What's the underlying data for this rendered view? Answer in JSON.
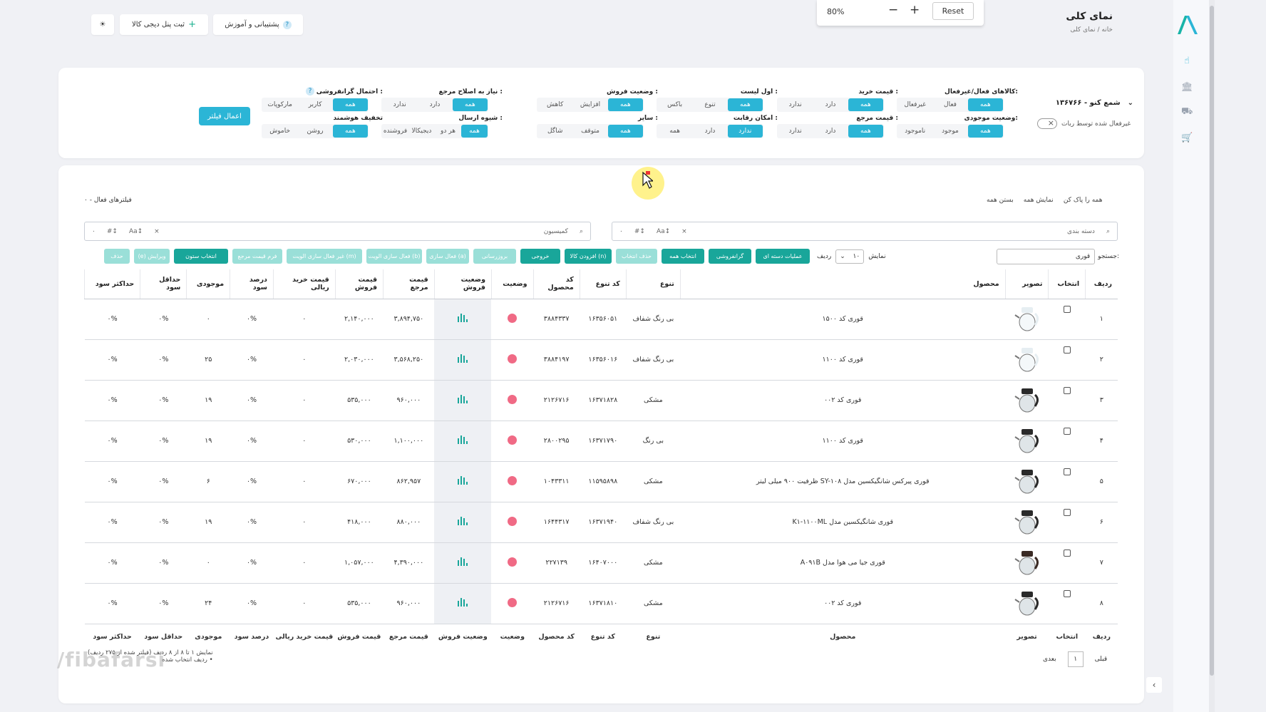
{
  "header": {
    "page_title": "نمای کلی",
    "breadcrumb_home": "خانه",
    "breadcrumb_sep": "/",
    "breadcrumb_current": "نمای کلی",
    "support_label": "پشتیبانی و آموزش",
    "register_panel_label": "ثبت پنل دیجی کالا"
  },
  "zoom": {
    "value": "80%",
    "reset_label": "Reset"
  },
  "filters": {
    "shop_name": "شمع کنو - ۱۳۶۷۶۶",
    "robot_toggle_label": "غیرفعال شده توسط ربات",
    "apply_label": "اعمال فیلتر",
    "groups": [
      {
        "label": "کالاهای فعال/غیرفعال:",
        "options": [
          "همه",
          "فعال",
          "غیرفعال"
        ],
        "active": 0
      },
      {
        "label": "وضعیت موجودی:",
        "options": [
          "همه",
          "موجود",
          "ناموجود"
        ],
        "active": 0
      },
      {
        "label": "قیمت خرید :",
        "options": [
          "همه",
          "دارد",
          "ندارد"
        ],
        "active": 0
      },
      {
        "label": "قیمت مرجع :",
        "options": [
          "همه",
          "دارد",
          "ندارد"
        ],
        "active": 0
      },
      {
        "label": "اول لیست :",
        "options": [
          "همه",
          "تنوع",
          "باکس"
        ],
        "active": 0
      },
      {
        "label": "امکان رقابت :",
        "options": [
          "ندارد",
          "دارد",
          "همه"
        ],
        "active": 0
      },
      {
        "label": "وضعیت فروش :",
        "options": [
          "همه",
          "افزایش",
          "کاهش"
        ],
        "active": 0
      },
      {
        "label": "سایر :",
        "options": [
          "همه",
          "متوقف",
          "شاگل"
        ],
        "active": 0
      },
      {
        "label": "نیاز به اصلاح مرجع :",
        "options": [
          "همه",
          "دارد",
          "ندارد"
        ],
        "active": 0
      },
      {
        "label": "شیوه ارسال :",
        "options": [
          "همه",
          "هر دو",
          "دیجیکالا",
          "فروشنده"
        ],
        "active": 0
      },
      {
        "label": "احتمال گرانفروشی :",
        "options": [
          "همه",
          "کاربر",
          "مارکوپات"
        ],
        "active": 0
      },
      {
        "label": "تخفیف هوشمند",
        "options": [
          "همه",
          "روشن",
          "خاموش"
        ],
        "active": 0
      }
    ]
  },
  "list": {
    "select_all_label": "همه را پاک کن",
    "show_all_label": "نمایش همه",
    "close_all_label": "بستن همه",
    "active_filters_label": "فیلترهای فعال - ۰",
    "category_search_placeholder": "دسته بندی",
    "commission_search_placeholder": "کمیسیون",
    "search_label": "جستجو:",
    "search_value": "قوری",
    "rows_label_show": "نمایش",
    "rows_label_rows": "ردیف",
    "rows_value": "۱۰",
    "toolbar": [
      {
        "label": "عملیات دسته ای",
        "style": "dark"
      },
      {
        "label": "گرانفروشی",
        "style": "dark"
      },
      {
        "label": "انتخاب همه",
        "style": "dark"
      },
      {
        "label": "حذف انتخاب",
        "style": "light"
      },
      {
        "label": "افزودن کالا (n)",
        "style": "dark"
      },
      {
        "label": "خروجی",
        "style": "dark"
      },
      {
        "label": "بروزرسانی",
        "style": "light"
      },
      {
        "label": "فعال سازی (a)",
        "style": "light"
      },
      {
        "label": "فعال سازی الویت (b)",
        "style": "light"
      },
      {
        "label": "غیر فعال سازی الویت (m)",
        "style": "light"
      },
      {
        "label": "فرم قیمت مرجع",
        "style": "light"
      },
      {
        "label": "انتخاب ستون",
        "style": "dark"
      },
      {
        "label": "(e) ویرایش",
        "style": "light"
      },
      {
        "label": "حذف",
        "style": "light"
      }
    ],
    "columns": [
      "ردیف",
      "انتخاب",
      "تصویر",
      "محصول",
      "تنوع",
      "کد تنوع",
      "کد محصول",
      "وضعیت",
      "وضعیت فروش",
      "قیمت مرجع",
      "قیمت فروش",
      "قیمت خرید ریالی",
      "درصد سود",
      "موجودی",
      "حداقل سود",
      "حداکثر سود"
    ],
    "rows": [
      {
        "idx": "۱",
        "product": "قوری کد ۱۵۰۰",
        "variant": "بی رنگ شفاف",
        "variant_code": "۱۶۳۵۶۰۵۱",
        "product_code": "۳۸۸۴۳۳۷",
        "ref_price": "۳,۸۹۴,۷۵۰",
        "sale_price": "۲,۱۴۰,۰۰۰",
        "buy_price": "۰",
        "profit_pct": "۰%",
        "stock": "۰",
        "min_profit": "۰%",
        "max_profit": "۰%",
        "img": "kettle-clear"
      },
      {
        "idx": "۲",
        "product": "قوری کد ۱۱۰۰",
        "variant": "بی رنگ شفاف",
        "variant_code": "۱۶۳۵۶۰۱۶",
        "product_code": "۳۸۸۴۱۹۷",
        "ref_price": "۳,۵۶۸,۲۵۰",
        "sale_price": "۲,۰۳۰,۰۰۰",
        "buy_price": "۰",
        "profit_pct": "۰%",
        "stock": "۲۵",
        "min_profit": "۰%",
        "max_profit": "۰%",
        "img": "teapot-clear"
      },
      {
        "idx": "۳",
        "product": "قوری کد ۰۰۲",
        "variant": "مشکی",
        "variant_code": "۱۶۳۷۱۸۲۸",
        "product_code": "۲۱۲۶۷۱۶",
        "ref_price": "۹۶۰,۰۰۰",
        "sale_price": "۵۳۵,۰۰۰",
        "buy_price": "۰",
        "profit_pct": "۰%",
        "stock": "۱۹",
        "min_profit": "۰%",
        "max_profit": "۰%",
        "img": "teapot-black"
      },
      {
        "idx": "۴",
        "product": "قوری کد ۱۱۰۰",
        "variant": "بی رنگ",
        "variant_code": "۱۶۳۷۱۷۹۰",
        "product_code": "۲۸۰۰۲۹۵",
        "ref_price": "۱,۱۰۰,۰۰۰",
        "sale_price": "۵۳۰,۰۰۰",
        "buy_price": "۰",
        "profit_pct": "۰%",
        "stock": "۱۹",
        "min_profit": "۰%",
        "max_profit": "۰%",
        "img": "teapot-dark"
      },
      {
        "idx": "۵",
        "product": "قوری پیرکس شانگیکسین مدل SY-۱۰۸ ظرفیت ۹۰۰ میلی لیتر",
        "variant": "مشکی",
        "variant_code": "۱۱۵۹۵۸۹۸",
        "product_code": "۱۰۴۳۳۱۱",
        "ref_price": "۸۶۲,۹۵۷",
        "sale_price": "۶۷۰,۰۰۰",
        "buy_price": "۰",
        "profit_pct": "۰%",
        "stock": "۶",
        "min_profit": "۰%",
        "max_profit": "۰%",
        "img": "teapot-black"
      },
      {
        "idx": "۶",
        "product": "قوری شانگیکسین مدل K۱-۱۱۰۰ML",
        "variant": "بی رنگ شفاف",
        "variant_code": "۱۶۳۷۱۹۴۰",
        "product_code": "۱۶۴۴۳۱۷",
        "ref_price": "۸۸۰,۰۰۰",
        "sale_price": "۴۱۸,۰۰۰",
        "buy_price": "۰",
        "profit_pct": "۰%",
        "stock": "۱۹",
        "min_profit": "۰%",
        "max_profit": "۰%",
        "img": "teapot-black"
      },
      {
        "idx": "۷",
        "product": "قوری جیا می هوا مدل A۰۹۱B",
        "variant": "مشکی",
        "variant_code": "۱۶۴۰۷۰۰۰",
        "product_code": "۲۲۷۱۳۹",
        "ref_price": "۴,۳۹۰,۰۰۰",
        "sale_price": "۱,۰۵۷,۰۰۰",
        "buy_price": "۰",
        "profit_pct": "۰%",
        "stock": "۰",
        "min_profit": "۰%",
        "max_profit": "۰%",
        "img": "teapot-brown"
      },
      {
        "idx": "۸",
        "product": "قوری کد ۰۰۲",
        "variant": "مشکی",
        "variant_code": "۱۶۳۷۱۸۱۰",
        "product_code": "۲۱۲۶۷۱۶",
        "ref_price": "۹۶۰,۰۰۰",
        "sale_price": "۵۳۵,۰۰۰",
        "buy_price": "۰",
        "profit_pct": "۰%",
        "stock": "۲۴",
        "min_profit": "۰%",
        "max_profit": "۰%",
        "img": "teapot-black"
      }
    ],
    "footer_info": "نمایش ۱ تا ۸ از ۸ ردیف (فیلتر شده از ۲۷۵ ردیف)",
    "footer_info2": "• ردیف انتخاب شده",
    "prev_label": "قبلی",
    "next_label": "بعدی",
    "page": "۱"
  },
  "watermark": "/fibafarsi",
  "colors": {
    "accent": "#2bb5d6",
    "teal": "#19a69a",
    "status_dot": "#f06a85"
  }
}
